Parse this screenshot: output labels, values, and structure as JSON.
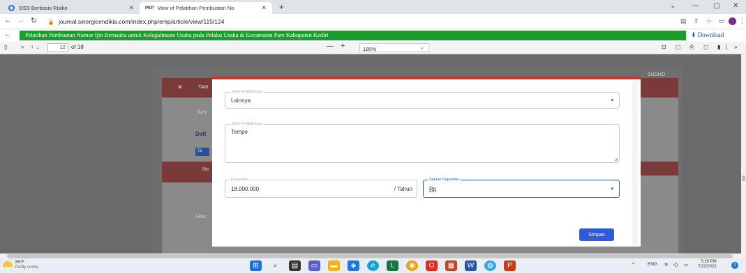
{
  "browser": {
    "tabs": [
      {
        "title": "OSS Berbasis Risiko",
        "icon": "oss-favicon"
      },
      {
        "title": "View of Pelatihan Pembuatan No",
        "icon": "pkp-favicon",
        "badge": "PKP"
      }
    ],
    "url": "journal.sinergicendikia.com/index.php/emp/article/view/115/124",
    "doc_title": "Pelatihan Pembuatan Nomor Ijin Berusaha untuk Kelegalitasan Usaha pada Pelaku Usaha di Kecamatan Pare Kabupaten Kediri",
    "download_label": "Download"
  },
  "pdf_toolbar": {
    "page": "12",
    "page_total": "of 18",
    "zoom": "180%"
  },
  "background_page": {
    "text_1": "TAM",
    "text_2": "Jum",
    "text_3": "Daft",
    "text_4": "Ta",
    "text_5": "No",
    "text_6": "Silak",
    "text_7": "SUDHO"
  },
  "modal": {
    "field1": {
      "label": "Jenis Produk/Jasa",
      "value": "Lainnya"
    },
    "field2": {
      "label": "Jenis Produk/Jasa",
      "value": "Tempe"
    },
    "field3": {
      "label": "Kapasitas",
      "value": "18.000.000",
      "suffix": "/ Tahun"
    },
    "field4": {
      "label": "Satuan Kapasitas",
      "value": "Rp"
    },
    "submit_label": "Simpan"
  },
  "taskbar": {
    "temp": "85°F",
    "weather": "Partly sunny",
    "lang": "ENG",
    "time": "5:29 PM",
    "date": "7/22/2022",
    "notif_count": "1"
  }
}
